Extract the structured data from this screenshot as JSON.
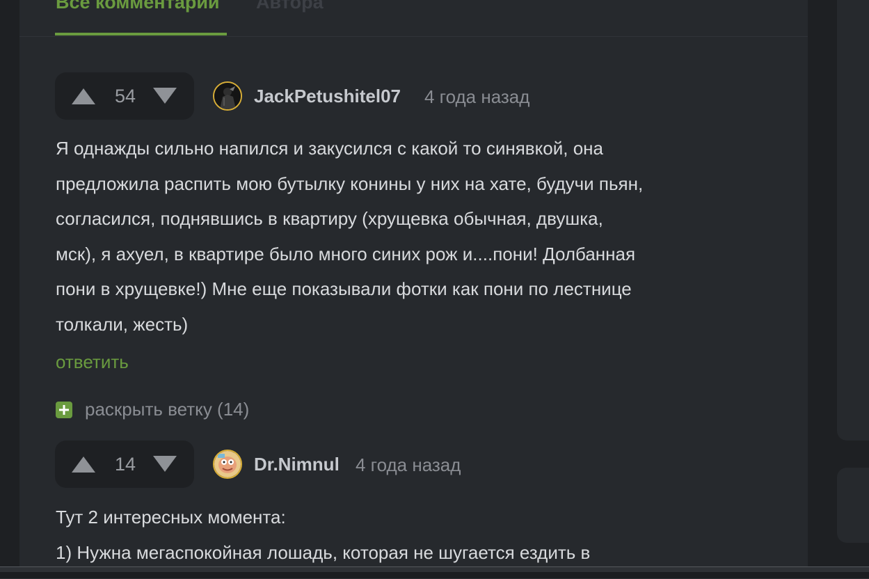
{
  "tabs": {
    "all_comments": "Все комментарии",
    "author": "Автора"
  },
  "comments": [
    {
      "rating": "54",
      "username": "JackPetushitel07",
      "time": "4 года назад",
      "lines": [
        "Я однажды сильно напился и закусился с какой то синявкой, она",
        "предложила распить мою бутылку конины у них на хате, будучи пьян,",
        "согласился, поднявшись в квартиру (хрущевка обычная, двушка,",
        "мск), я ахуел, в квартире было много синих рож и....пони! Долбанная",
        "пони в хрущевке!) Мне еще показывали фотки как пони по лестнице",
        "толкали, жесть)"
      ],
      "reply": "ответить",
      "expand": "раскрыть ветку (14)"
    },
    {
      "rating": "14",
      "username": "Dr.Nimnul",
      "time": "4 года назад",
      "lines": [
        "Тут 2 интересных момента:",
        "1) Нужна мегаспокойная лошадь, которая не шугается ездить в"
      ]
    }
  ],
  "colors": {
    "accent": "#6a9b3f",
    "panel": "#26292d",
    "background": "#1e2023",
    "text": "#d8dadd",
    "muted": "#8a8d93",
    "avatar_border": "#d8ae37"
  },
  "icons": [
    "arrow-up-icon",
    "arrow-down-icon",
    "plus-icon"
  ]
}
